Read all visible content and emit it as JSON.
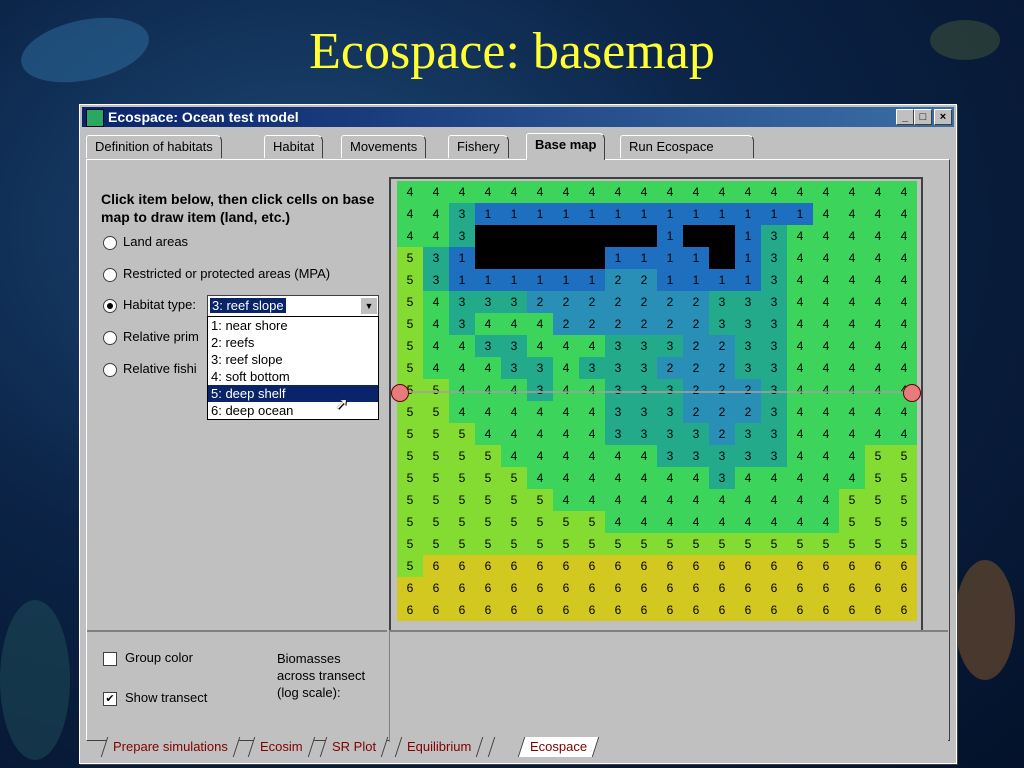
{
  "slide": {
    "title": "Ecospace: basemap"
  },
  "window": {
    "title": "Ecospace: Ocean test model",
    "controls": {
      "minimize": "_",
      "maximize": "□",
      "close": "×"
    }
  },
  "tabs": [
    {
      "label": "Definition of habitats"
    },
    {
      "label": "Habitat"
    },
    {
      "label": "Movements"
    },
    {
      "label": "Fishery"
    },
    {
      "label": "Base map",
      "active": true
    },
    {
      "label": "Run Ecospace"
    }
  ],
  "left_panel": {
    "instructions": "Click item below, then click cells on base map to draw item (land, etc.)",
    "options": [
      {
        "label": "Land areas",
        "selected": false
      },
      {
        "label": "Restricted or protected areas (MPA)",
        "selected": false
      },
      {
        "label": "Habitat type:",
        "selected": true
      },
      {
        "label": "Relative prim",
        "selected": false
      },
      {
        "label": "Relative fishi",
        "selected": false
      }
    ],
    "habitat_combo": {
      "value": "3: reef slope"
    },
    "habitat_dropdown": [
      {
        "label": "1: near shore"
      },
      {
        "label": "2: reefs"
      },
      {
        "label": "3: reef slope"
      },
      {
        "label": "4: soft bottom"
      },
      {
        "label": "5: deep shelf",
        "highlighted": true
      },
      {
        "label": "6: deep ocean"
      }
    ]
  },
  "bottom_panel": {
    "group_color": {
      "label": "Group color",
      "checked": false
    },
    "show_transect": {
      "label": "Show transect",
      "checked": true
    },
    "biomass_label": [
      "Biomasses",
      "across transect",
      "(log scale):"
    ]
  },
  "basemap": {
    "cols": 20,
    "rows": 20,
    "colors": {
      "1": "#1f6fc0",
      "2": "#2a8fb6",
      "3": "#23aa8a",
      "4": "#3cd45a",
      "5": "#84dc32",
      "6": "#d2c820",
      "L": "#000000"
    },
    "grid": [
      "44444444444444444444",
      "44311111111111114444",
      "443LLLLLLL1LL1344444",
      "531LLLLL1111L1344444",
      "53111111221111344444",
      "54333222222233344444",
      "54344422222233344444",
      "54433444333223344444",
      "54443343332223344444",
      "55444344333222344444",
      "55444444333222344444",
      "55544444333323344444",
      "55554444443333344455",
      "55555444444434444455",
      "55555544444444444555",
      "55555555444444444555",
      "55555555555555555555",
      "56666666666666666666",
      "66666666666666666666",
      "66666666666666666666"
    ],
    "transect_row": 9
  },
  "sheet_tabs": [
    {
      "label": "Prepare simulations"
    },
    {
      "label": "Ecosim"
    },
    {
      "label": "SR Plot"
    },
    {
      "label": "Equilibrium"
    },
    {
      "label": ""
    },
    {
      "label": "Ecospace",
      "active": true
    }
  ]
}
